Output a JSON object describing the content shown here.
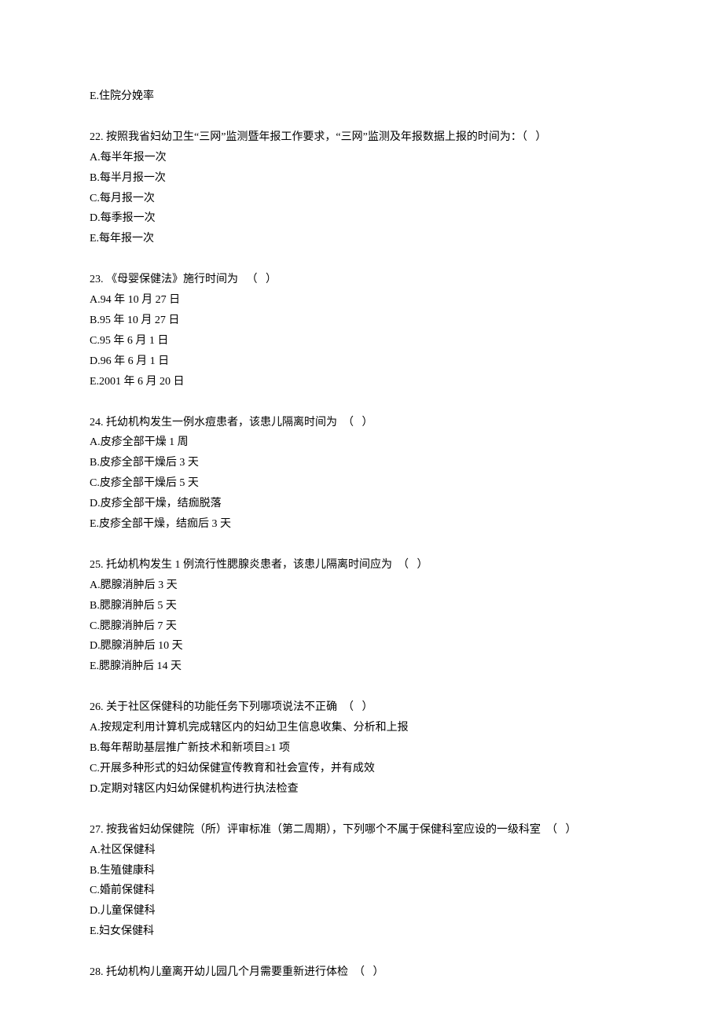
{
  "lines": [
    {
      "text": "E.住院分娩率"
    },
    {
      "spacer": true
    },
    {
      "text": "22. 按照我省妇幼卫生“三网”监测暨年报工作要求，“三网”监测及年报数据上报的时间为：（   ）"
    },
    {
      "text": "A.每半年报一次"
    },
    {
      "text": "B.每半月报一次"
    },
    {
      "text": "C.每月报一次"
    },
    {
      "text": "D.每季报一次"
    },
    {
      "text": "E.每年报一次"
    },
    {
      "spacer": true
    },
    {
      "text": "23. 《母婴保健法》施行时间为   （   ）"
    },
    {
      "text": "A.94 年 10 月 27 日"
    },
    {
      "text": "B.95 年 10 月 27 日"
    },
    {
      "text": "C.95 年 6 月 1 日"
    },
    {
      "text": "D.96 年 6 月 1 日"
    },
    {
      "text": "E.2001 年 6 月 20 日"
    },
    {
      "spacer": true
    },
    {
      "text": "24. 托幼机构发生一例水痘患者，该患儿隔离时间为  （   ）"
    },
    {
      "text": "A.皮疹全部干燥 1 周"
    },
    {
      "text": "B.皮疹全部干燥后 3 天"
    },
    {
      "text": "C.皮疹全部干燥后 5 天"
    },
    {
      "text": "D.皮疹全部干燥，结痂脱落"
    },
    {
      "text": "E.皮疹全部干燥，结痂后 3 天"
    },
    {
      "spacer": true
    },
    {
      "text": "25. 托幼机构发生 1 例流行性腮腺炎患者，该患儿隔离时间应为  （   ）"
    },
    {
      "text": "A.腮腺消肿后 3 天"
    },
    {
      "text": "B.腮腺消肿后 5 天"
    },
    {
      "text": "C.腮腺消肿后 7 天"
    },
    {
      "text": "D.腮腺消肿后 10 天"
    },
    {
      "text": "E.腮腺消肿后 14 天"
    },
    {
      "spacer": true
    },
    {
      "text": "26. 关于社区保健科的功能任务下列哪项说法不正确  （   ）"
    },
    {
      "text": "A.按规定利用计算机完成辖区内的妇幼卫生信息收集、分析和上报"
    },
    {
      "text": "B.每年帮助基层推广新技术和新项目≥1 项"
    },
    {
      "text": "C.开展多种形式的妇幼保健宣传教育和社会宣传，并有成效"
    },
    {
      "text": "D.定期对辖区内妇幼保健机构进行执法检查"
    },
    {
      "spacer": true
    },
    {
      "text": "27. 按我省妇幼保健院（所）评审标准（第二周期），下列哪个不属于保健科室应设的一级科室  （   ）"
    },
    {
      "text": "A.社区保健科"
    },
    {
      "text": "B.生殖健康科"
    },
    {
      "text": "C.婚前保健科"
    },
    {
      "text": "D.儿童保健科"
    },
    {
      "text": "E.妇女保健科"
    },
    {
      "spacer": true
    },
    {
      "text": "28. 托幼机构儿童离开幼儿园几个月需要重新进行体检  （   ）"
    }
  ]
}
